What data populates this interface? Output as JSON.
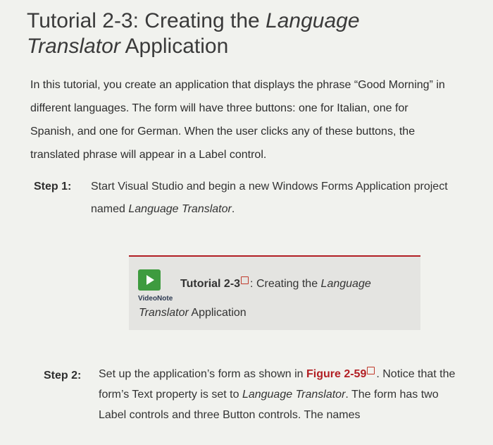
{
  "title": {
    "line1_prefix": "Tutorial 2-3: Creating the ",
    "line1_italic": "Language",
    "line2_italic": "Translator",
    "line2_suffix": " Application"
  },
  "intro": "In this tutorial, you create an application that displays the phrase “Good Morning” in different languages. The form will have three buttons: one for Italian, one for Spanish, and one for German. When the user clicks any of these buttons, the translated phrase will appear in a Label control.",
  "step1": {
    "label": "Step 1:",
    "text_prefix": "Start Visual Studio and begin a new Windows Forms Application project named ",
    "text_italic": "Language Translator",
    "text_suffix": "."
  },
  "videonote": {
    "label": "VideoNote",
    "title_bold": "Tutorial 2-3",
    "title_rest": ": Creating the ",
    "title_italic": "Language",
    "sub_italic": "Translator",
    "sub_rest": " Application"
  },
  "step2": {
    "label": "Step 2:",
    "text_a": "Set up the application’s form as shown in ",
    "figure_ref": "Figure 2-59",
    "text_b": ". Notice that the form’s Text property is set to ",
    "text_italic": "Language Translator",
    "text_c": ". The form has two Label controls and three Button controls. The names"
  },
  "colors": {
    "accent_red": "#b21f24",
    "play_green": "#3e9b3f"
  },
  "icons": [
    "play-icon",
    "link-icon"
  ]
}
